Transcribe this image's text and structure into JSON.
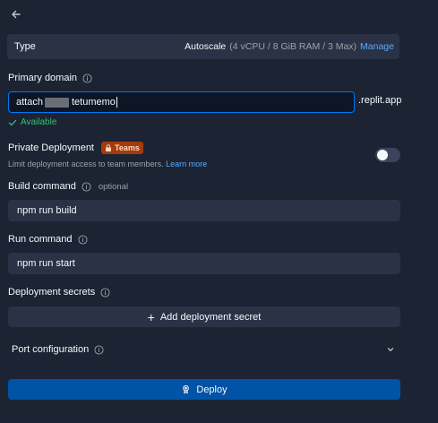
{
  "type": {
    "label": "Type",
    "value": "Autoscale",
    "spec": "(4 vCPU / 8 GiB RAM / 3 Max)",
    "manage_link": "Manage"
  },
  "primary_domain": {
    "label": "Primary domain",
    "value_prefix": "attach",
    "value_suffix": "tetumemo",
    "suffix": ".replit.app",
    "status": "Available"
  },
  "private_deployment": {
    "label": "Private Deployment",
    "badge": "Teams",
    "description": "Limit deployment access to team members.",
    "learn_more": "Learn more",
    "enabled": false
  },
  "build_command": {
    "label": "Build command",
    "optional_note": "optional",
    "value": "npm run build"
  },
  "run_command": {
    "label": "Run command",
    "value": "npm run start"
  },
  "deployment_secrets": {
    "label": "Deployment secrets",
    "add_button": "Add deployment secret"
  },
  "port_configuration": {
    "label": "Port configuration"
  },
  "deploy_button": "Deploy",
  "colors": {
    "background": "#1c2333",
    "surface": "#2b3245",
    "accent_blue": "#0053a6",
    "link_blue": "#57abff",
    "success_green": "#3dbf71",
    "teams_badge": "#a33b0c"
  },
  "icons": {
    "back": "arrow-left-icon",
    "info": "info-circle-icon",
    "check": "check-icon",
    "lock": "lock-icon",
    "plus": "plus-icon",
    "chevron": "chevron-down-icon",
    "deploy": "deploy-icon"
  }
}
